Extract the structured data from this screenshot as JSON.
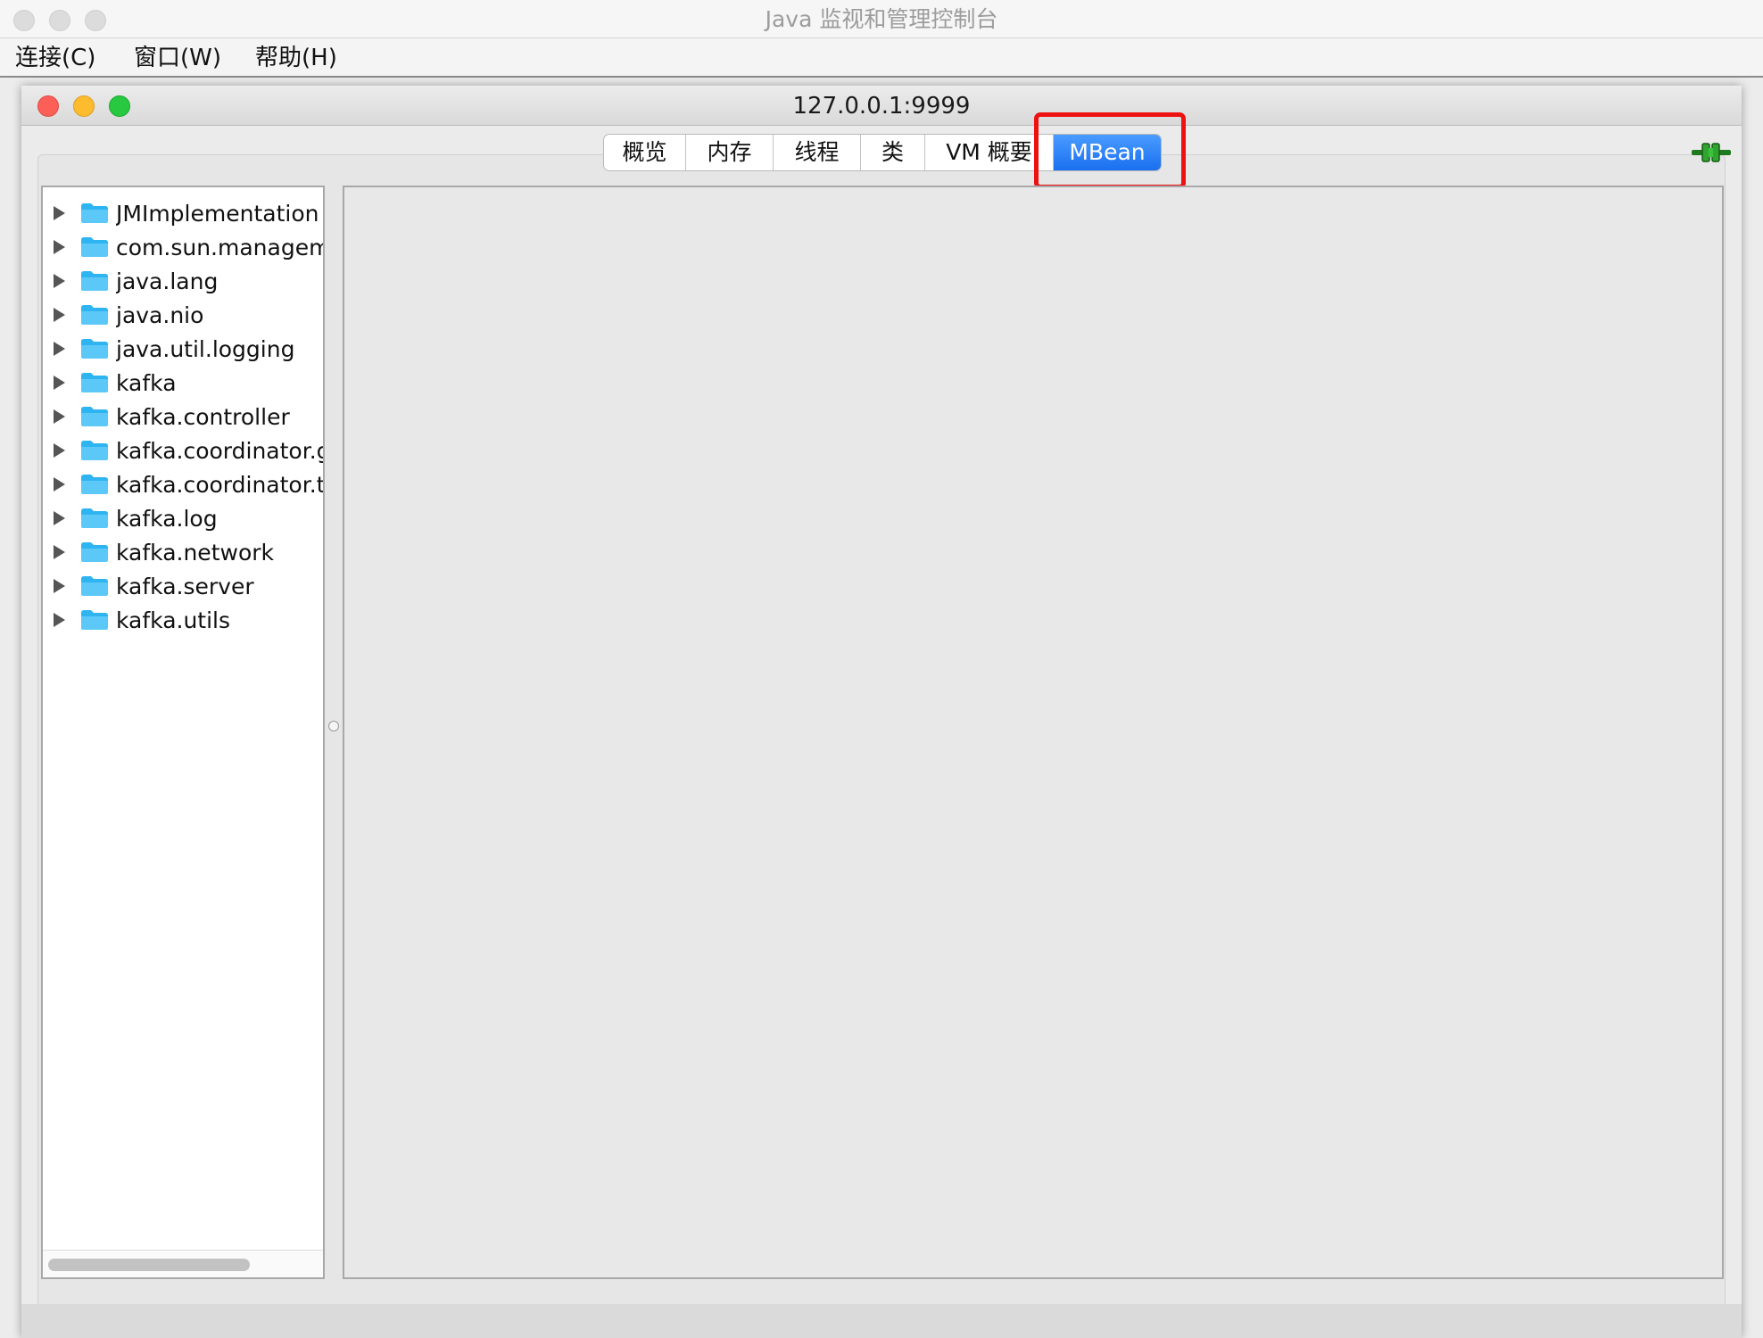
{
  "app": {
    "title": "Java 监视和管理控制台"
  },
  "menu": {
    "items": [
      {
        "label": "连接(C)"
      },
      {
        "label": "窗口(W)"
      },
      {
        "label": "帮助(H)"
      }
    ]
  },
  "window": {
    "title": "127.0.0.1:9999"
  },
  "tabs": {
    "items": [
      {
        "label": "概览"
      },
      {
        "label": "内存"
      },
      {
        "label": "线程"
      },
      {
        "label": "类"
      },
      {
        "label": "VM 概要"
      },
      {
        "label": "MBean"
      }
    ],
    "active": "MBean",
    "highlight_color": "#ee1111"
  },
  "tree": {
    "items": [
      {
        "label": "JMImplementation"
      },
      {
        "label": "com.sun.manageme"
      },
      {
        "label": "java.lang"
      },
      {
        "label": "java.nio"
      },
      {
        "label": "java.util.logging"
      },
      {
        "label": "kafka"
      },
      {
        "label": "kafka.controller"
      },
      {
        "label": "kafka.coordinator.gr"
      },
      {
        "label": "kafka.coordinator.tr"
      },
      {
        "label": "kafka.log"
      },
      {
        "label": "kafka.network"
      },
      {
        "label": "kafka.server"
      },
      {
        "label": "kafka.utils"
      }
    ],
    "folder_color": "#2fb4f2"
  },
  "icons": {
    "connection": "plug-connected-icon"
  }
}
